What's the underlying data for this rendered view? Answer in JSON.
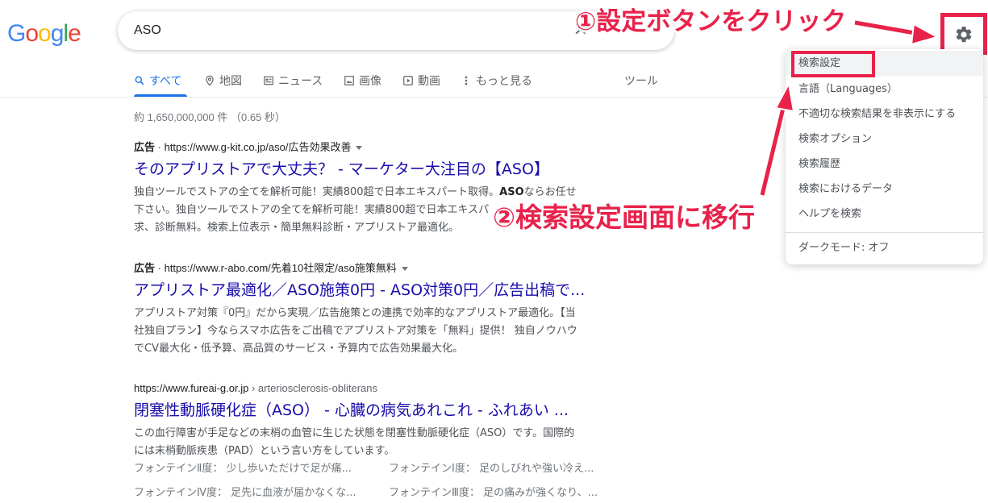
{
  "header": {
    "logo": {
      "letters": [
        "G",
        "o",
        "o",
        "g",
        "l",
        "e"
      ],
      "colors": [
        "#4285f4",
        "#ea4335",
        "#fbbc05",
        "#4285f4",
        "#34a853",
        "#ea4335"
      ]
    },
    "search_value": "ASO",
    "clear_icon": "close-icon",
    "settings_icon": "gear-icon"
  },
  "tabs": [
    {
      "label": "すべて",
      "icon": "search-icon",
      "active": true
    },
    {
      "label": "地図",
      "icon": "map-pin-icon"
    },
    {
      "label": "ニュース",
      "icon": "news-icon"
    },
    {
      "label": "画像",
      "icon": "image-icon"
    },
    {
      "label": "動画",
      "icon": "video-icon"
    },
    {
      "label": "もっと見る",
      "icon": "more-vert-icon"
    }
  ],
  "tools_label": "ツール",
  "result_stats": "約 1,650,000,000 件 （0.65 秒）",
  "results": [
    {
      "ad_label": "広告",
      "url": "https://www.g-kit.co.jp/aso/広告効果改善",
      "title": "そのアプリストアで大丈夫？ - マーケター大注目の【ASO】",
      "snippet_lines": [
        "独自ツールでストアの全てを解析可能！実績800超で日本エキスパート取得。ASOならお任せ",
        "下さい。独自ツールでストアの全てを解析可能！実績800超で日本エキスパ",
        "求、診断無料。検索上位表示・簡単無料診断・アプリストア最適化。"
      ]
    },
    {
      "ad_label": "広告",
      "url": "https://www.r-abo.com/先着10社限定/aso施策無料",
      "title": "アプリストア最適化／ASO施策0円 - ASO対策0円／広告出稿で...",
      "snippet_lines": [
        "アプリストア対策『0円』だから実現／広告施策との連携で効率的なアプリストア最適化。【当",
        "社独自プラン】今ならスマホ広告をご出稿でアプリストア対策を「無料」提供！ 独自ノウハウ",
        "でCV最大化・低予算、高品質のサービス・予算内で広告効果最大化。"
      ]
    },
    {
      "url": "https://www.fureai-g.or.jp",
      "breadcrumb": " › arteriosclerosis-obliterans",
      "title": "閉塞性動脈硬化症（ASO） - 心臓の病気あれこれ - ふれあい ...",
      "snippet_lines": [
        "この血行障害が手足などの末梢の血管に生じた状態を閉塞性動脈硬化症（ASO）です。国際的",
        "には末梢動脈疾患（PAD）という言い方をしています。"
      ],
      "sublinks": [
        [
          "フォンテインⅡ度： 少し歩いただけで足が痛...",
          "フォンテインⅠ度： 足のしびれや強い冷え..."
        ],
        [
          "フォンテインⅣ度： 足先に血液が届かなくな...",
          "フォンテインⅢ度： 足の痛みが強くなり、..."
        ]
      ]
    }
  ],
  "settings_menu": {
    "items": [
      "検索設定",
      "言語（Languages）",
      "不適切な検索結果を非表示にする",
      "検索オプション",
      "検索履歴",
      "検索におけるデータ",
      "ヘルプを検索"
    ],
    "dark_mode": "ダークモード: オフ"
  },
  "annotations": {
    "step1": "①設定ボタンをクリック",
    "step2": "②検索設定画面に移行",
    "color": "#e8224a"
  }
}
